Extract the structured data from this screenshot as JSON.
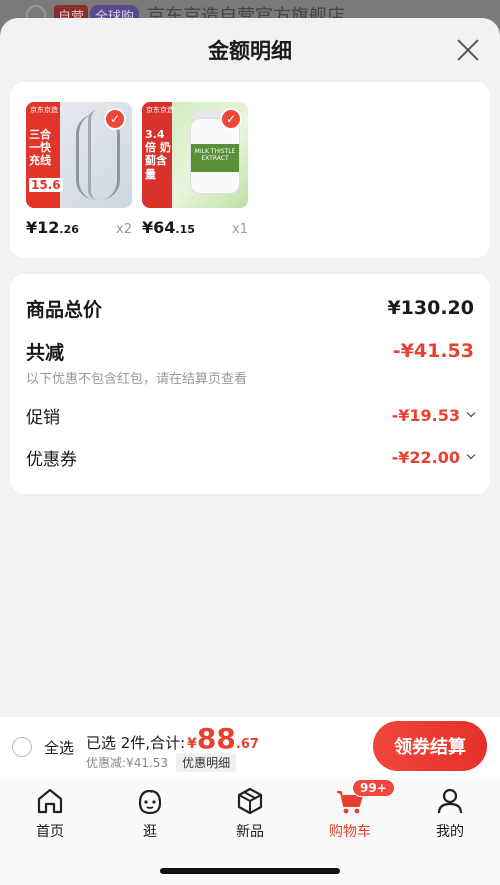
{
  "background": {
    "store_tag_1": "自营",
    "store_tag_2": "全球购",
    "store_name": "京东京造自营官方旗舰店"
  },
  "sheet": {
    "title": "金额明细",
    "close_icon": "close-icon"
  },
  "products": [
    {
      "image_brand": "京东京造",
      "image_text": "三合一快充线",
      "image_number": "15.6",
      "price_int": "¥12",
      "price_dec": ".26",
      "qty": "x2"
    },
    {
      "image_brand": "京东京造",
      "image_text": "3.4倍 奶蓟含量",
      "image_label": "MILK THISTLE EXTRACT",
      "price_int": "¥64",
      "price_dec": ".15",
      "qty": "x1"
    }
  ],
  "summary": {
    "total_label": "商品总价",
    "total_value": "¥130.20",
    "discount_label": "共减",
    "discount_value": "-¥41.53",
    "note": "以下优惠不包含红包，请在结算页查看",
    "promo_label": "促销",
    "promo_value": "-¥19.53",
    "coupon_label": "优惠券",
    "coupon_value": "-¥22.00"
  },
  "checkout": {
    "select_all": "全选",
    "selected_text": "已选 2件,合计:",
    "yen": "¥",
    "amount_int": "88",
    "amount_dec": ".67",
    "discount_text": "优惠减:¥41.53",
    "detail_tag": "优惠明细",
    "button": "领券结算"
  },
  "tabbar": {
    "tabs": [
      {
        "label": "首页",
        "icon": "home-icon"
      },
      {
        "label": "逛",
        "icon": "face-icon"
      },
      {
        "label": "新品",
        "icon": "cube-icon"
      },
      {
        "label": "购物车",
        "icon": "cart-icon",
        "active": true
      },
      {
        "label": "我的",
        "icon": "user-icon"
      }
    ],
    "cart_badge": "99+"
  },
  "colors": {
    "accent": "#e8412f",
    "check": "#f1463a"
  }
}
